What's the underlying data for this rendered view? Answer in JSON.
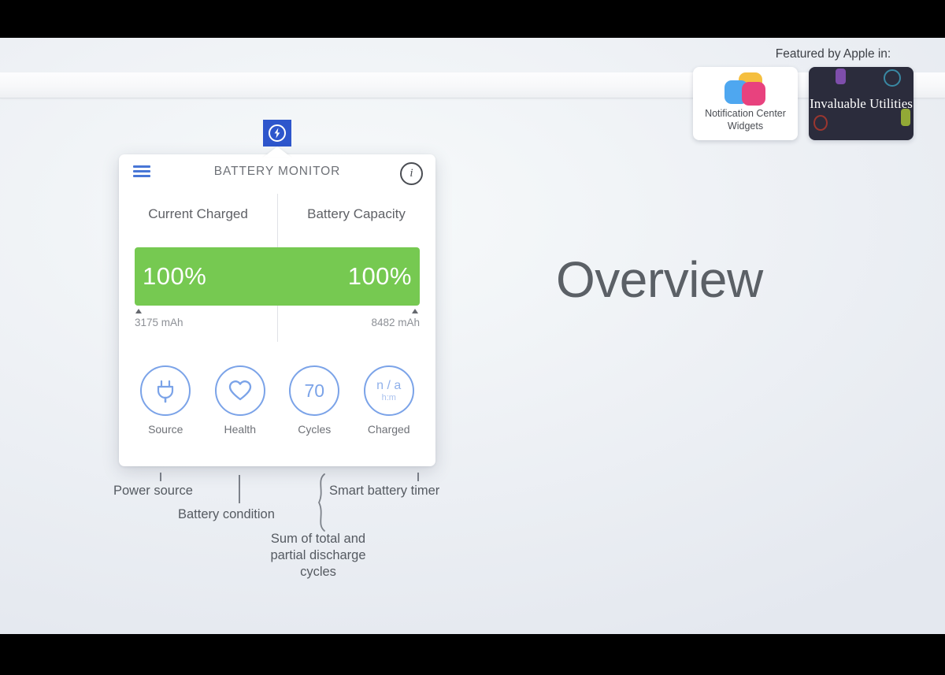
{
  "slide": {
    "heading": "Overview"
  },
  "menubar": {
    "app_icon_name": "battery-bolt-icon"
  },
  "card": {
    "title": "BATTERY MONITOR",
    "menu_icon": "hamburger-icon",
    "info_icon": "info-icon",
    "columns": [
      {
        "label": "Current Charged",
        "value": "100%",
        "footnote": "3175 mAh"
      },
      {
        "label": "Battery Capacity",
        "value": "100%",
        "footnote": "8482 mAh"
      }
    ],
    "bar_color": "#76c951",
    "stats": [
      {
        "label": "Source",
        "icon": "power-plug-icon",
        "value": ""
      },
      {
        "label": "Health",
        "icon": "heart-icon",
        "value": ""
      },
      {
        "label": "Cycles",
        "icon": "",
        "value": "70"
      },
      {
        "label": "Charged",
        "icon": "",
        "value": "n / a",
        "sub": "h:m"
      }
    ]
  },
  "annotations": {
    "power_source": "Power source",
    "battery_condition": "Battery condition",
    "cycles_note": "Sum of total and partial discharge cycles",
    "smart_timer": "Smart battery timer"
  },
  "featured": {
    "label": "Featured by Apple in:",
    "badges": [
      {
        "title": "Notification Center Widgets"
      },
      {
        "title": "Invaluable Utilities"
      }
    ]
  }
}
